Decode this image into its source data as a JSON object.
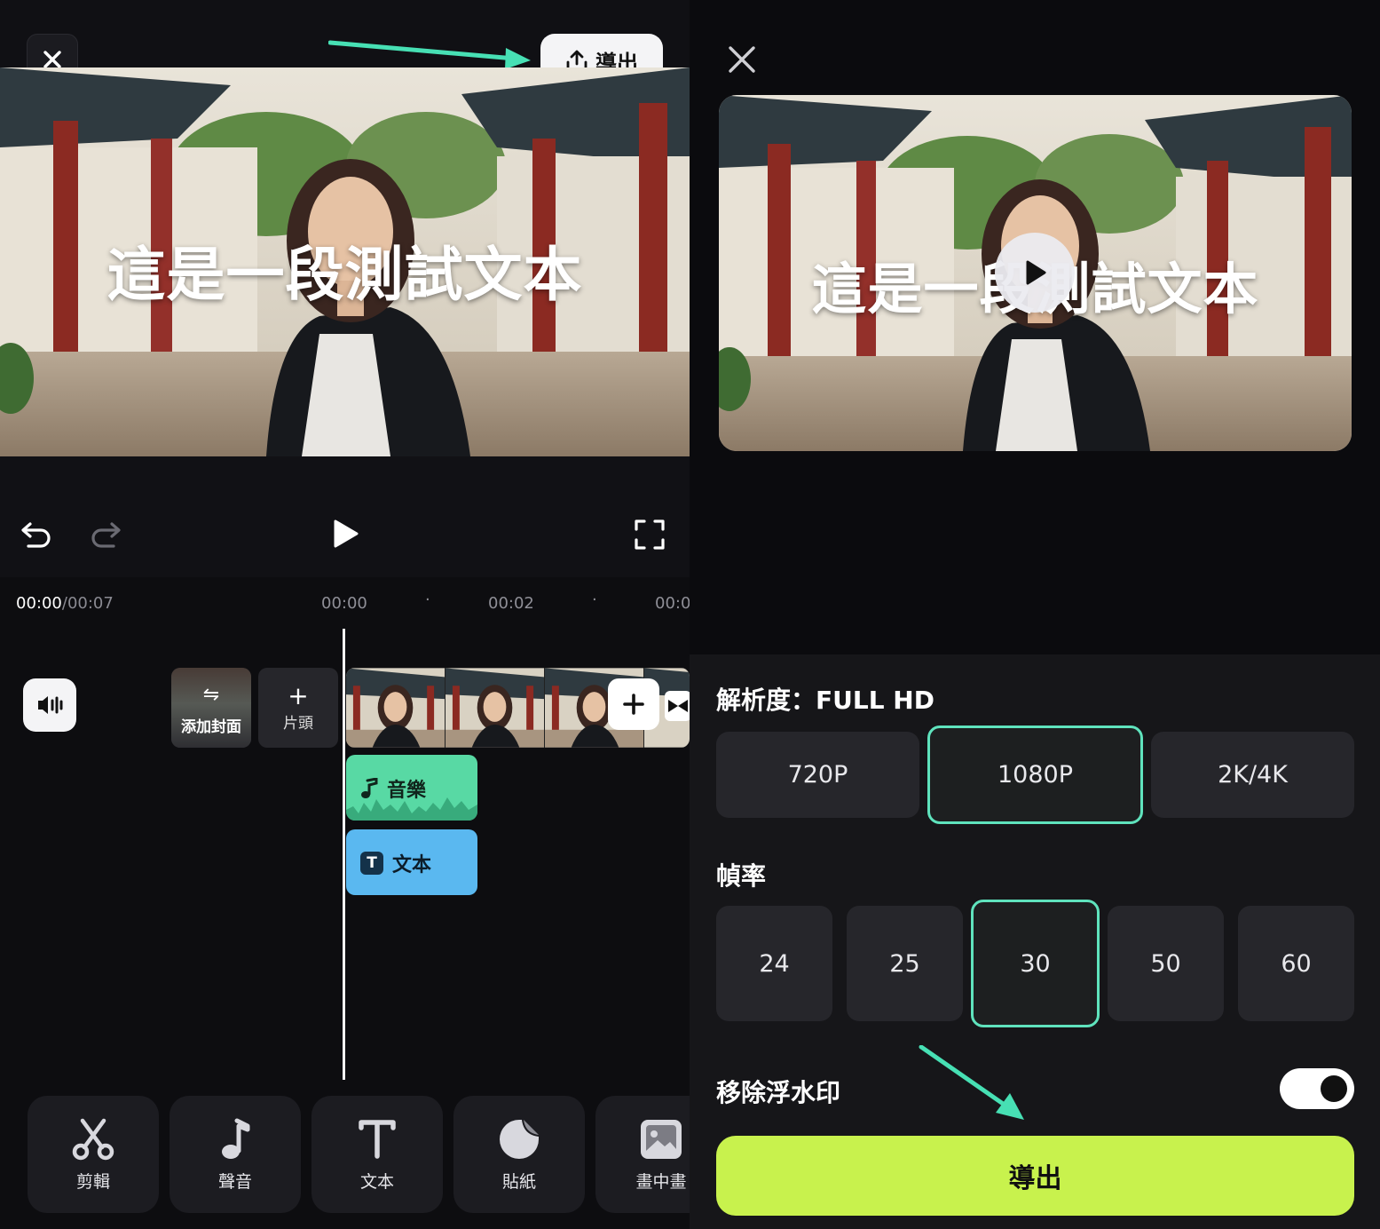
{
  "editor": {
    "export_label": "導出",
    "caption": "這是一段測試文本",
    "time": {
      "current": "00:00",
      "total": "/00:07"
    },
    "ruler": [
      "00:00",
      "00:02",
      "00:0"
    ],
    "cover_label": "添加封面",
    "intro_label": "片頭",
    "music_label": "音樂",
    "text_label": "文本",
    "tools": [
      {
        "label": "剪輯",
        "icon": "scissors-icon"
      },
      {
        "label": "聲音",
        "icon": "music-note-icon"
      },
      {
        "label": "文本",
        "icon": "text-icon"
      },
      {
        "label": "貼紙",
        "icon": "sticker-icon"
      },
      {
        "label": "畫中畫",
        "icon": "picture-in-picture-icon"
      }
    ]
  },
  "export_panel": {
    "caption": "這是一段測試文本",
    "resolution_title": "解析度：FULL HD",
    "resolutions": [
      "720P",
      "1080P",
      "2K/4K"
    ],
    "resolution_selected": "1080P",
    "framerate_title": "幀率",
    "framerates": [
      "24",
      "25",
      "30",
      "50",
      "60"
    ],
    "framerate_selected": "30",
    "watermark_label": "移除浮水印",
    "watermark_on": true,
    "export_button": "導出"
  },
  "colors": {
    "accent": "#5fe3bd",
    "export_button": "#c8f24d",
    "music_track": "#58d9a4",
    "text_track": "#5ab8f0"
  }
}
